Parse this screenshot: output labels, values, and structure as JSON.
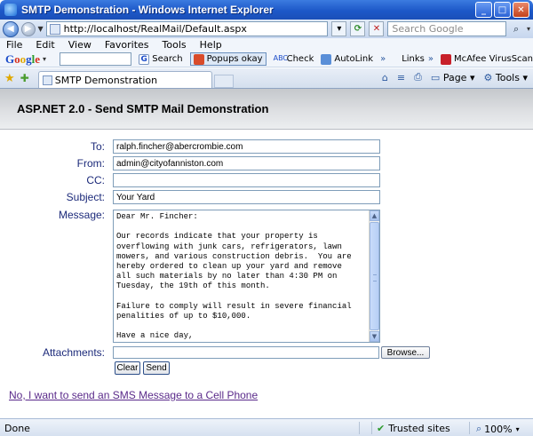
{
  "window": {
    "title": "SMTP Demonstration - Windows Internet Explorer",
    "controls": {
      "minimize": "_",
      "maximize": "□",
      "close": "✕"
    }
  },
  "address": {
    "url": "http://localhost/RealMail/Default.aspx",
    "search_placeholder": "Search Google"
  },
  "menu": [
    "File",
    "Edit",
    "View",
    "Favorites",
    "Tools",
    "Help"
  ],
  "google_toolbar": {
    "search_label": "Search",
    "popups_label": "Popups okay",
    "check_label": "Check",
    "autolink_label": "AutoLink",
    "links_label": "Links",
    "mcafee_label": "McAfee VirusScan"
  },
  "tab": {
    "label": "SMTP Demonstration"
  },
  "commands": {
    "page_label": "Page",
    "tools_label": "Tools"
  },
  "page": {
    "heading": "ASP.NET 2.0 - Send SMTP Mail Demonstration",
    "labels": {
      "to": "To:",
      "from": "From:",
      "cc": "CC:",
      "subject": "Subject:",
      "message": "Message:",
      "attachments": "Attachments:"
    },
    "fields": {
      "to": "ralph.fincher@abercrombie.com",
      "from": "admin@cityofanniston.com",
      "cc": "",
      "subject": "Your Yard",
      "attachments": ""
    },
    "message_text": "Dear Mr. Fincher:\n\nOur records indicate that your property is\noverflowing with junk cars, refrigerators, lawn\nmowers, and various construction debris.  You are\nhereby ordered to clean up your yard and remove\nall such materials by no later than 4:30 PM on\nTuesday, the 19th of this month.\n\nFailure to comply will result in severe financial\npenalities of up to $10,000.\n\nHave a nice day,",
    "browse_label": "Browse...",
    "clear_label": "Clear",
    "send_label": "Send",
    "sms_link": "No, I want to send an SMS Message to a Cell Phone"
  },
  "status": {
    "text": "Done",
    "zone": "Trusted sites",
    "zoom": "100%"
  }
}
